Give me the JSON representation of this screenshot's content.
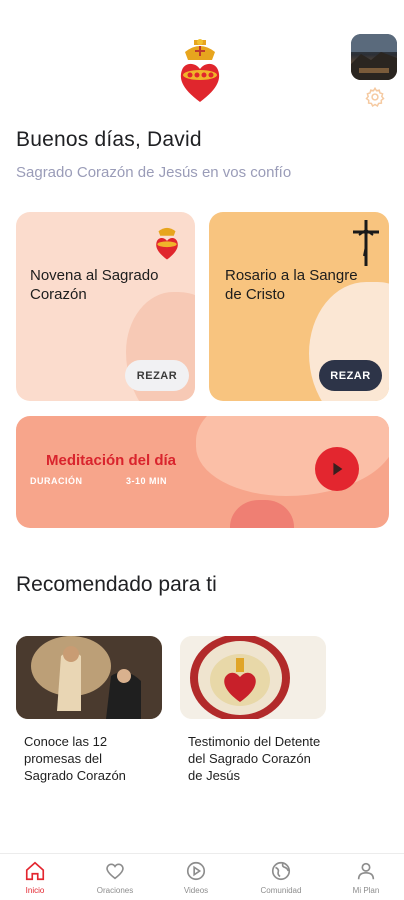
{
  "header": {
    "greeting": "Buenos días, David",
    "subtitle": "Sagrado Corazón de Jesús en vos confío"
  },
  "cards": {
    "novena": {
      "title": "Novena al Sagrado Corazón",
      "button": "REZAR"
    },
    "rosario": {
      "title": "Rosario a la Sangre de Cristo",
      "button": "REZAR"
    },
    "meditacion": {
      "title": "Meditación del día",
      "duration_label": "DURACIÓN",
      "duration_value": "3-10 MIN"
    }
  },
  "recommended": {
    "title": "Recomendado para ti",
    "items": [
      {
        "title": "Conoce las 12 promesas del Sagrado Corazón"
      },
      {
        "title": "Testimonio del Detente del Sagrado Corazón de Jesús"
      }
    ]
  },
  "tabs": [
    {
      "label": "Inicio",
      "icon": "home-icon",
      "active": true
    },
    {
      "label": "Oraciones",
      "icon": "heart-icon",
      "active": false
    },
    {
      "label": "Videos",
      "icon": "play-circle-icon",
      "active": false
    },
    {
      "label": "Comunidad",
      "icon": "globe-icon",
      "active": false
    },
    {
      "label": "Mi Plan",
      "icon": "user-icon",
      "active": false
    }
  ],
  "colors": {
    "accent": "#e3262f",
    "novena_bg": "#fbdccd",
    "rosario_bg": "#f8c47f",
    "meditacion_bg": "#f7a58b",
    "dark_button": "#2d3448",
    "subtitle": "#9a9cb8"
  }
}
